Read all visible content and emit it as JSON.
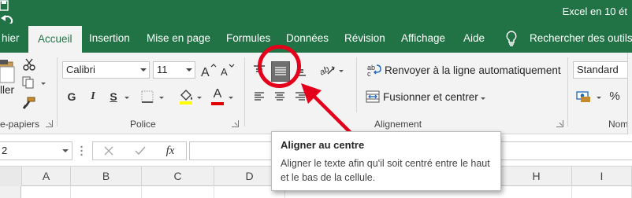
{
  "window": {
    "title": "Excel en 10 ét"
  },
  "tabs": [
    {
      "id": "fichier",
      "label": "hier"
    },
    {
      "id": "accueil",
      "label": "Accueil",
      "active": true
    },
    {
      "id": "insertion",
      "label": "Insertion"
    },
    {
      "id": "mise-en-page",
      "label": "Mise en page"
    },
    {
      "id": "formules",
      "label": "Formules"
    },
    {
      "id": "donnees",
      "label": "Données"
    },
    {
      "id": "revision",
      "label": "Révision"
    },
    {
      "id": "affichage",
      "label": "Affichage"
    },
    {
      "id": "aide",
      "label": "Aide"
    }
  ],
  "search": {
    "label": "Rechercher des outils"
  },
  "clipboard": {
    "paste_label": "ller",
    "group_label": "e-papiers"
  },
  "font": {
    "name": "Calibri",
    "size": "11",
    "bold": "G",
    "italic": "I",
    "underline": "S",
    "color_letter": "A",
    "group_label": "Police",
    "font_color": "#e00000",
    "highlight_color": "#ffff00"
  },
  "alignment": {
    "wrap_label": "Renvoyer à la ligne automatiquement",
    "merge_label": "Fusionner et centrer",
    "group_label": "Alignement"
  },
  "number": {
    "format": "Standard",
    "percent": "%",
    "group_label": "Nom"
  },
  "formula_bar": {
    "name_box": "2",
    "fx": "fx"
  },
  "columns": [
    "A",
    "B",
    "C",
    "D",
    "E",
    "F",
    "G",
    "H",
    "I"
  ],
  "tooltip": {
    "title": "Aligner au centre",
    "description": "Aligner le texte afin qu'il soit centré entre le haut et le bas de la cellule."
  },
  "colors": {
    "excel_green": "#217346",
    "annotation_red": "#e4001b",
    "ribbon_bg": "#f3f3f3"
  }
}
